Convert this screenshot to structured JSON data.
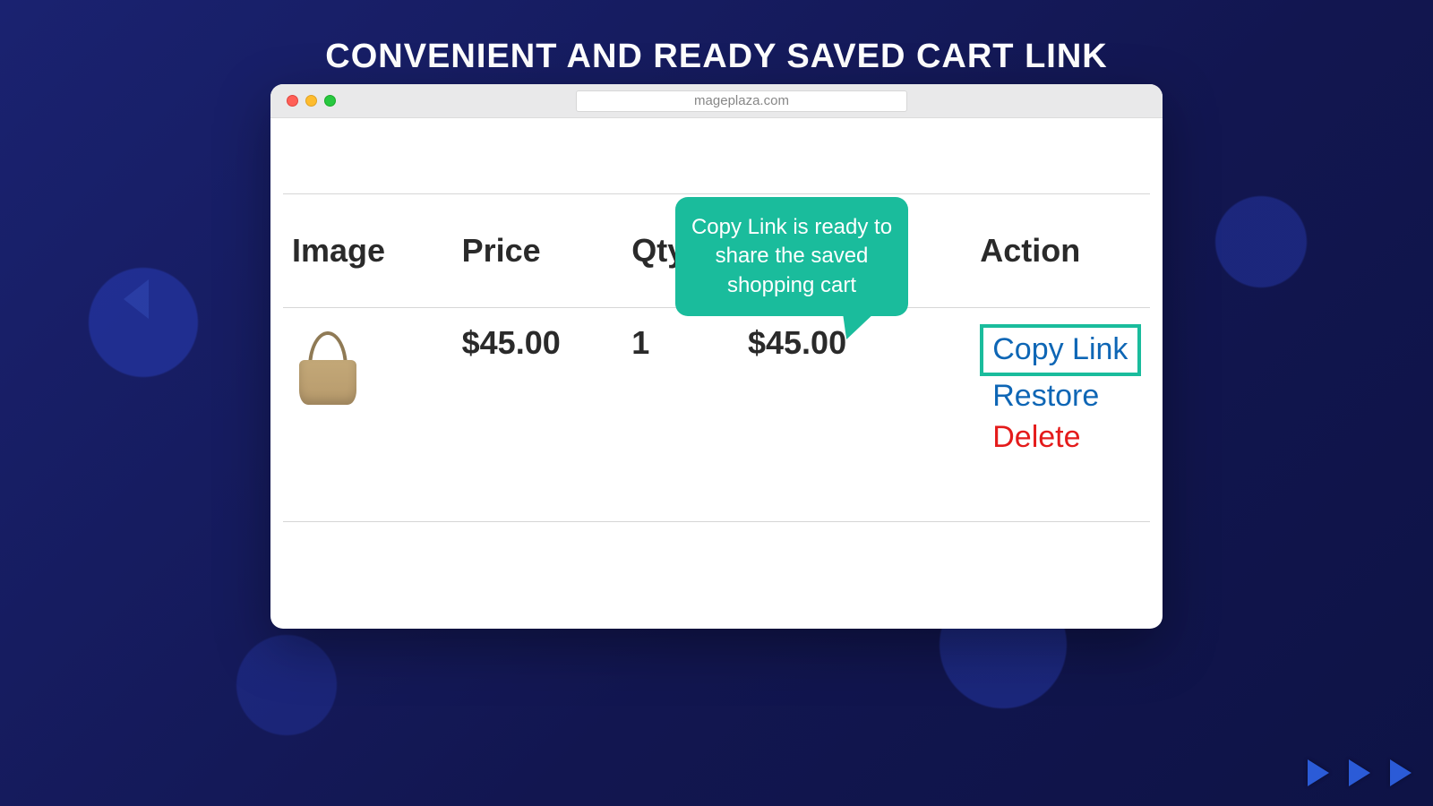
{
  "hero": {
    "title": "CONVENIENT AND READY SAVED CART LINK"
  },
  "browser": {
    "address": "mageplaza.com"
  },
  "table": {
    "headers": {
      "image": "Image",
      "price": "Price",
      "qty": "Qty",
      "subtotal_hidden": "",
      "action": "Action"
    },
    "row": {
      "price": "$45.00",
      "qty": "1",
      "subtotal": "$45.00",
      "actions": {
        "copy": "Copy Link",
        "restore": "Restore",
        "delete": "Delete"
      }
    }
  },
  "tooltip": {
    "text": "Copy Link is ready to share the saved shopping cart"
  }
}
